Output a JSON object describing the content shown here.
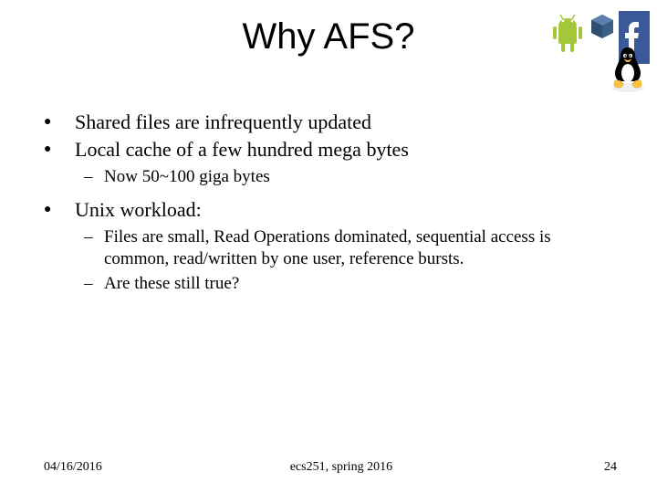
{
  "title": "Why AFS?",
  "bullets": {
    "b1": "Shared files are infrequently updated",
    "b2": "Local cache of a few hundred mega bytes",
    "b2_sub1": "Now 50~100 giga bytes",
    "b3": "Unix workload:",
    "b3_sub1": "Files are small, Read Operations dominated, sequential access is common, read/written by one user, reference bursts.",
    "b3_sub2": "Are these still true?"
  },
  "footer": {
    "date": "04/16/2016",
    "course": "ecs251, spring 2016",
    "page": "24"
  },
  "glyphs": {
    "bullet": "●",
    "dash": "–"
  }
}
